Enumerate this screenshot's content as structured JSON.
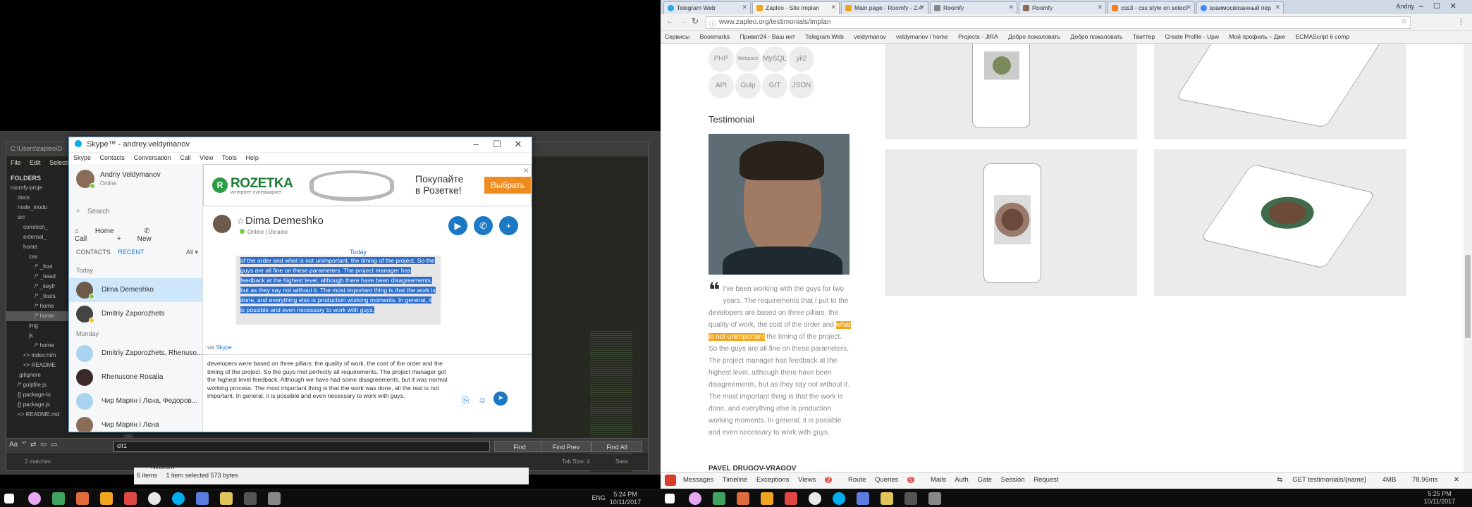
{
  "left": {
    "sublime": {
      "title": "C:\\Users\\zapleo\\D",
      "menu": [
        "File",
        "Edit",
        "Selection"
      ],
      "folders_header": "FOLDERS",
      "tree": [
        "roomfy-proje",
        "docs",
        "node_modu",
        "src",
        "common_",
        "external_",
        "home",
        "css",
        "/* _foot",
        "/* _head",
        "/* _keyfr",
        "/* _tours",
        "/* home",
        "/* home",
        "img",
        "js",
        "/* home",
        "<> index.htm",
        "<> README",
        ".gitignore",
        "/* gulpfile.js",
        "{} package-lo",
        "{} package.js",
        "<> README.md"
      ],
      "line_no": "389",
      "find_value": "clt1",
      "find_btn": "Find",
      "find_prev_btn": "Find Prev",
      "find_all_btn": "Find All",
      "status_left": "2 matches",
      "status_tab": "Tab Size: 4",
      "status_syntax": "Sass"
    },
    "explorer": {
      "network": "Network",
      "items": "6 items",
      "selected": "1 item selected  573 bytes"
    },
    "skype": {
      "window_title": "Skype™ - andrey.veldymanov",
      "menu": [
        "Skype",
        "Contacts",
        "Conversation",
        "Call",
        "View",
        "Tools",
        "Help"
      ],
      "profile_name": "Andriy Veldymanov",
      "profile_status": "Online",
      "search_placeholder": "Search",
      "nav": {
        "home": "Home",
        "call": "Call",
        "new": "New"
      },
      "tabs": {
        "contacts": "CONTACTS",
        "recent": "RECENT",
        "filter": "All"
      },
      "sections": {
        "today": "Today",
        "monday": "Monday"
      },
      "contacts": [
        "Dima Demeshko",
        "Dmitriy Zaporozhets",
        "Dmitriy Zaporozhets, Rhenuso...",
        "Rhenusone Rosalia",
        "Чир Марян і Лєна, Федоров...",
        "Чир Марян і Лєна"
      ],
      "ad": {
        "brand": "ROZETKA",
        "brand_sub": "интернет-супермаркет",
        "text_line1": "Покупайте",
        "text_line2": "в Розетке!",
        "button": "Выбрать"
      },
      "conversation": {
        "name": "Dima Demeshko",
        "status": "Online | Ukraine",
        "day": "Today",
        "message": "of the order and what is not unimportant, the timing of the project. So the guys are all fine on these parameters. The project manager has feedback at the highest level, although there have been disagreements, but as they say not without it. The most important thing is that the work is done, and everything else is production working moments. In general, it is possible and even necessary to work with guys.",
        "via": "via",
        "via_app": "Skype",
        "compose": "developers were based on three pillars: the quality of work, the cost of the order and the timing of the project. So the guys met perfectly all requirements. The project manager got the highest level feedback. Although we have had some disagreements, but it was normal working process. The most important thing is that the work was done, all the rest is not important. In general, it is possible and even necessary to work with guys."
      }
    },
    "tray": {
      "lang": "ENG",
      "time": "5:24 PM",
      "date": "10/11/2017"
    }
  },
  "right": {
    "tabs": [
      {
        "label": "Telegram Web",
        "color": "#2ca5e0"
      },
      {
        "label": "Zapleo - Site Implan",
        "color": "#f0a51e"
      },
      {
        "label": "Main page - Roomfy - 2.4",
        "color": "#f0a51e"
      },
      {
        "label": "Roomfy",
        "color": "#888888"
      },
      {
        "label": "Roomfy",
        "color": "#8a6d57"
      },
      {
        "label": "css3 - css style on select",
        "color": "#f48024"
      },
      {
        "label": "взаимосвязанный пер",
        "color": "#4285f4"
      }
    ],
    "profile": "Andriy",
    "url": "www.zapleo.org/testimonials/implan",
    "bookmarks": [
      "Сервисы",
      "Bookmarks",
      "Приват24 - Ваш инт",
      "Telegram Web",
      "veldymanov",
      "veldymanov / home",
      "Projects - JIRA",
      "Добро пожаловать",
      "Добро пожаловать",
      "Твиттер",
      "Create Profile - Upw",
      "Мой профиль – Дже",
      "ECMAScript 6 comp"
    ],
    "skills": [
      "PHP",
      "Webpack",
      "MySQL",
      "yii2",
      "API",
      "Gulp",
      "GIT",
      "JSON"
    ],
    "testimonial_title": "Testimonial",
    "quote_lines_before": "I've been working with the guys for two years. The requirements that I put to the developers are based on three pillars: the quality of work, the cost of the order and",
    "quote_highlight": "what is not unimportant",
    "quote_after": "the timing of the project. So the guys are all fine on these parameters. The project manager has feedback at the highest level, although there have been disagreements, but as they say not without it. The most important thing is that the work is done, and everything else is production working moments. In general, it is possible and even necessary to work with guys.",
    "author": "PAVEL DRUGOV-VRAGOV",
    "debug": {
      "items": [
        "Messages",
        "Timeline",
        "Exceptions",
        "Views",
        "Route",
        "Queries",
        "Mails",
        "Auth",
        "Gate",
        "Session",
        "Request"
      ],
      "views_count": "2",
      "queries_count": "5",
      "route": "GET testimonials/{name}",
      "memory": "4MB",
      "time": "78.96ms"
    },
    "tray": {
      "time": "5:25 PM",
      "date": "10/11/2017"
    }
  }
}
